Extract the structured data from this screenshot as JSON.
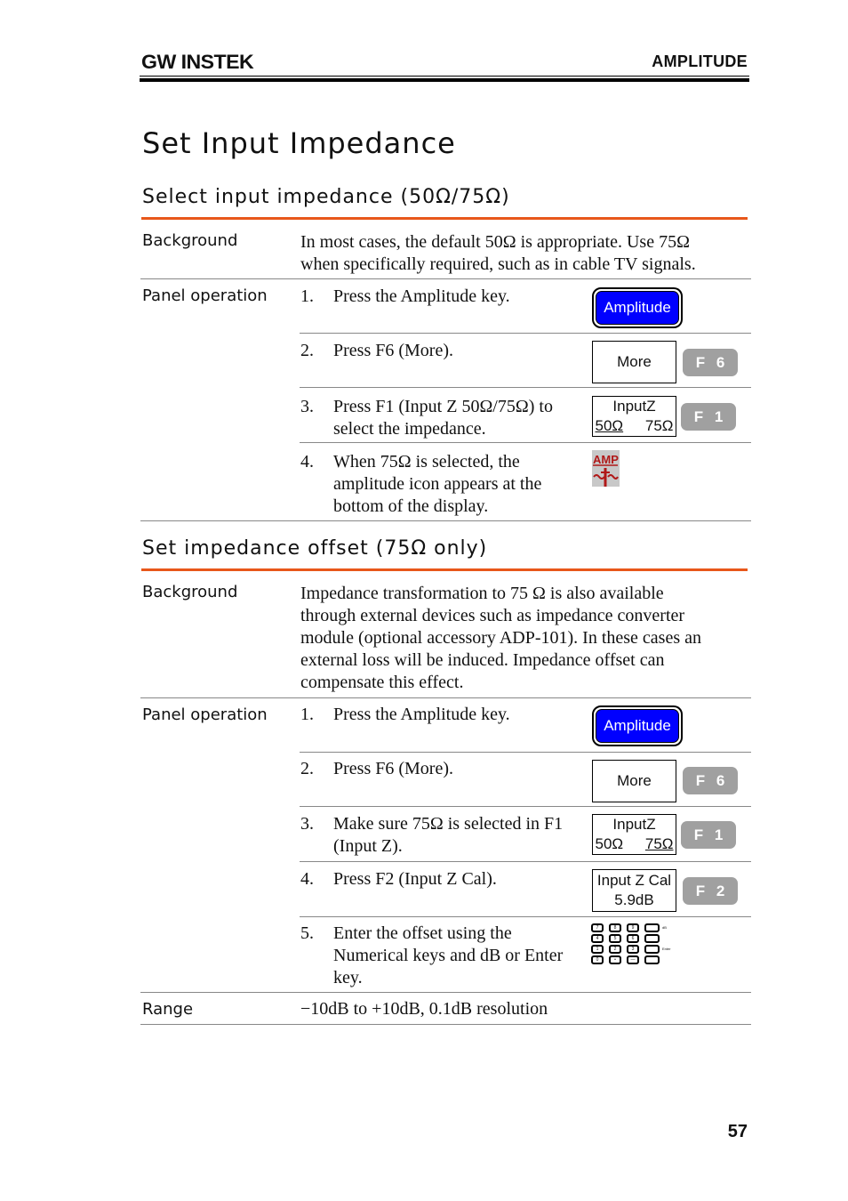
{
  "header": {
    "brand": "GW INSTEK",
    "section": "AMPLITUDE"
  },
  "page_title": "Set Input Impedance",
  "sections": [
    {
      "title": "Select input impedance (50Ω/75Ω)",
      "background_label": "Background",
      "background_text": [
        "In most cases, the default 50Ω is appropriate. Use 75Ω",
        "when specifically required, such as in cable TV signals."
      ],
      "panel_label": "Panel operation",
      "steps": [
        {
          "num": "1.",
          "lines": [
            "Press the Amplitude key."
          ],
          "key": "Amplitude"
        },
        {
          "num": "2.",
          "lines": [
            "Press F6 (More)."
          ],
          "softkey": "More",
          "fkey": "F 6"
        },
        {
          "num": "3.",
          "lines": [
            "Press F1 (Input Z 50Ω/75Ω) to",
            "select the impedance."
          ],
          "softkey_title": "InputZ",
          "options": [
            "50Ω",
            "75Ω"
          ],
          "selected": "50Ω",
          "fkey": "F 1"
        },
        {
          "num": "4.",
          "lines": [
            "When 75Ω is selected, the",
            "amplitude icon appears at the",
            "bottom of  the display."
          ],
          "icon": "amp-75ohm-icon",
          "icon_text": "AMP"
        }
      ]
    },
    {
      "title": "Set impedance offset (75Ω only)",
      "background_label": "Background",
      "background_text": [
        "Impedance transformation to 75 Ω is also available",
        "through external devices such as impedance converter",
        "module (optional accessory ADP-101). In these cases an",
        "external loss will be induced. Impedance offset can",
        "compensate this effect."
      ],
      "panel_label": "Panel operation",
      "steps": [
        {
          "num": "1.",
          "lines": [
            "Press the Amplitude key."
          ],
          "key": "Amplitude"
        },
        {
          "num": "2.",
          "lines": [
            "Press F6 (More)."
          ],
          "softkey": "More",
          "fkey": "F 6"
        },
        {
          "num": "3.",
          "lines": [
            "Make sure 75Ω is selected in F1",
            "(Input Z)."
          ],
          "softkey_title": "InputZ",
          "options": [
            "50Ω",
            "75Ω"
          ],
          "selected": "75Ω",
          "fkey": "F 1"
        },
        {
          "num": "4.",
          "lines": [
            "Press F2 (Input Z Cal)."
          ],
          "softkey_title": "Input Z Cal",
          "softkey_value": "5.9dB",
          "fkey": "F 2"
        },
        {
          "num": "5.",
          "lines": [
            "Enter the offset using the",
            "Numerical keys and dB or Enter",
            "key."
          ],
          "keypad": {
            "keys": [
              "7",
              "8",
              "9",
              "",
              "4",
              "5",
              "6",
              "",
              "1",
              "2",
              "3",
              "",
              "0",
              "•",
              "—",
              ""
            ],
            "side_labels": [
              "dB",
              "",
              "Enter",
              ""
            ]
          }
        }
      ],
      "range_label": "Range",
      "range_text": "−10dB to +10dB, 0.1dB resolution"
    }
  ],
  "page_number": "57"
}
